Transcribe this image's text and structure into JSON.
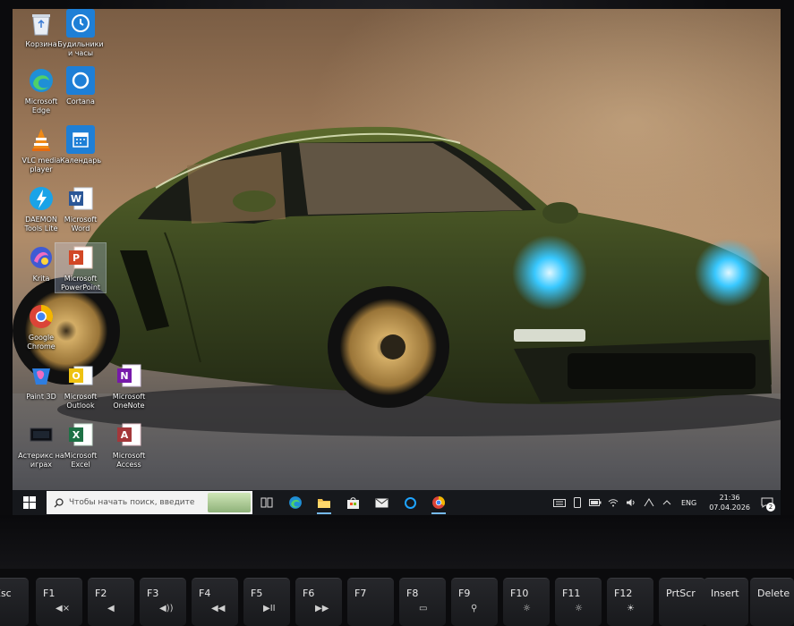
{
  "desktop": {
    "icons": [
      {
        "label": "Корзина",
        "icon": "recycle-bin-icon"
      },
      {
        "label": "Будильники\nи часы",
        "icon": "alarm-clock-icon"
      },
      {
        "label": "Microsoft\nEdge",
        "icon": "edge-icon"
      },
      {
        "label": "Cortana",
        "icon": "cortana-icon"
      },
      {
        "label": "VLC media\nplayer",
        "icon": "vlc-icon"
      },
      {
        "label": "Календарь",
        "icon": "calendar-icon"
      },
      {
        "label": "DAEMON\nTools Lite",
        "icon": "daemon-tools-icon"
      },
      {
        "label": "Microsoft\nWord",
        "icon": "word-icon"
      },
      {
        "label": "Krita",
        "icon": "krita-icon"
      },
      {
        "label": "Microsoft\nPowerPoint",
        "icon": "powerpoint-icon"
      },
      {
        "label": "Google\nChrome",
        "icon": "chrome-icon"
      },
      {
        "label": "Paint 3D",
        "icon": "paint3d-icon"
      },
      {
        "label": "Microsoft\nOutlook",
        "icon": "outlook-icon"
      },
      {
        "label": "Microsoft\nOneNote",
        "icon": "onenote-icon"
      },
      {
        "label": "Астерикс на\nиграх",
        "icon": "game-icon"
      },
      {
        "label": "Microsoft\nExcel",
        "icon": "excel-icon"
      },
      {
        "label": "Microsoft\nAccess",
        "icon": "access-icon"
      }
    ]
  },
  "taskbar": {
    "search_placeholder": "Чтобы начать поиск, введите",
    "apps": [
      "task-view-icon",
      "edge-icon",
      "file-explorer-icon",
      "store-icon",
      "mail-icon",
      "cortana-icon",
      "chrome-icon"
    ],
    "language": "ENG",
    "time": "21:36",
    "date": "07.04.2026",
    "notification_count": "2"
  },
  "keyboard": {
    "keys": [
      {
        "label": "Esc",
        "sub": ""
      },
      {
        "label": "F1",
        "sub": "◀×"
      },
      {
        "label": "F2",
        "sub": "◀"
      },
      {
        "label": "F3",
        "sub": "◀))"
      },
      {
        "label": "F4",
        "sub": "◀◀"
      },
      {
        "label": "F5",
        "sub": "▶II"
      },
      {
        "label": "F6",
        "sub": "▶▶"
      },
      {
        "label": "F7",
        "sub": ""
      },
      {
        "label": "F8",
        "sub": "▭"
      },
      {
        "label": "F9",
        "sub": "⚲"
      },
      {
        "label": "F10",
        "sub": "☼"
      },
      {
        "label": "F11",
        "sub": "☼"
      },
      {
        "label": "F12",
        "sub": "☀"
      },
      {
        "label": "PrtScr",
        "sub": ""
      },
      {
        "label": "Insert",
        "sub": ""
      },
      {
        "label": "Delete",
        "sub": ""
      }
    ]
  },
  "colors": {
    "taskbar_bg": "#16181c",
    "car_body": "#3f4a1f",
    "wheel_gold": "#b08a4a",
    "headlight_blue": "#38c8ff"
  }
}
